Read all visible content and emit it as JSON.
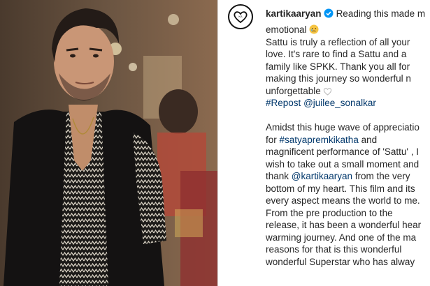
{
  "post": {
    "username": "kartikaaryan",
    "header_text": "Reading this made m",
    "lines": [
      {
        "text": "emotional",
        "emoji": "crying-face-icon"
      },
      {
        "text": "Sattu is truly a reflection of all your"
      },
      {
        "text": "love. It's rare to find a Sattu and a"
      },
      {
        "text": "family like SPKK. Thank you all for"
      },
      {
        "text": "making this journey so wonderful n"
      },
      {
        "text": "unforgettable",
        "emoji": "white-heart-icon"
      }
    ],
    "repost": {
      "tag": "#Repost",
      "mention": "@juilee_sonalkar"
    },
    "quote_lines": [
      {
        "parts": [
          {
            "t": "Amidst this huge wave of appreciatio"
          }
        ]
      },
      {
        "parts": [
          {
            "t": "for "
          },
          {
            "t": "#satyapremkikatha",
            "link": true
          },
          {
            "t": " and"
          }
        ]
      },
      {
        "parts": [
          {
            "t": "magnificent performance of 'Sattu' , I"
          }
        ]
      },
      {
        "parts": [
          {
            "t": "wish to take out a small moment and"
          }
        ]
      },
      {
        "parts": [
          {
            "t": "thank "
          },
          {
            "t": "@kartikaaryan",
            "link": true
          },
          {
            "t": " from the very"
          }
        ]
      },
      {
        "parts": [
          {
            "t": "bottom of my heart. This film and its"
          }
        ]
      },
      {
        "parts": [
          {
            "t": "every aspect means the world to me."
          }
        ]
      },
      {
        "parts": [
          {
            "t": "From the pre production to the"
          }
        ]
      },
      {
        "parts": [
          {
            "t": "release, it has been a wonderful hear"
          }
        ]
      },
      {
        "parts": [
          {
            "t": "warming journey. And one of the ma"
          }
        ]
      },
      {
        "parts": [
          {
            "t": "reasons for that is this wonderful"
          }
        ]
      },
      {
        "parts": [
          {
            "t": "wonderful Superstar who has alway"
          }
        ]
      }
    ]
  },
  "colors": {
    "link": "#00376b",
    "text": "#262626",
    "verified": "#0095f6",
    "divider": "#dbdbdb"
  }
}
